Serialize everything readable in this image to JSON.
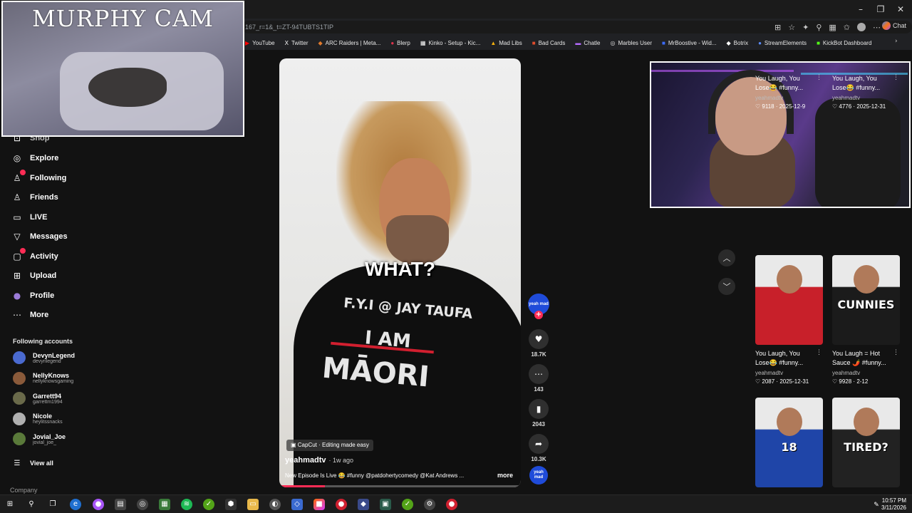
{
  "browser": {
    "address": "167_r=1&_t=ZT-94TUBTS1TIP",
    "chat_label": "Chat",
    "bookmarks": [
      {
        "icon": "youtube-icon",
        "glyph": "▶",
        "label": "YouTube",
        "color": "#ff0000"
      },
      {
        "icon": "x-icon",
        "glyph": "X",
        "label": "Twitter",
        "color": "#ffffff"
      },
      {
        "icon": "arc-icon",
        "glyph": "◆",
        "label": "ARC Raiders | Meta...",
        "color": "#e07a2c"
      },
      {
        "icon": "blerp-icon",
        "glyph": "●",
        "label": "Blerp",
        "color": "#e0334d"
      },
      {
        "icon": "kinko-icon",
        "glyph": "▦",
        "label": "Kinko - Setup - Kic...",
        "color": "#ffffff"
      },
      {
        "icon": "madlibs-icon",
        "glyph": "▲",
        "label": "Mad Libs",
        "color": "#f6b10c"
      },
      {
        "icon": "badcards-icon",
        "glyph": "■",
        "label": "Bad Cards",
        "color": "#e04c2c"
      },
      {
        "icon": "chatle-icon",
        "glyph": "▬",
        "label": "Chatle",
        "color": "#b66cff"
      },
      {
        "icon": "globe-icon",
        "glyph": "◎",
        "label": "Marbles User",
        "color": "#dddddd"
      },
      {
        "icon": "mrboost-icon",
        "glyph": "■",
        "label": "MrBoostive - Wid...",
        "color": "#3b6cff"
      },
      {
        "icon": "botrix-icon",
        "glyph": "◆",
        "label": "Botrix",
        "color": "#ffffff"
      },
      {
        "icon": "streamelements-icon",
        "glyph": "●",
        "label": "StreamElements",
        "color": "#5a8cff"
      },
      {
        "icon": "kickbot-icon",
        "glyph": "■",
        "label": "KickBot Dashboard",
        "color": "#53fc18"
      }
    ]
  },
  "cam1": {
    "title": "MURPHY CAM"
  },
  "sidebar": {
    "partial_label": "Shop",
    "items": [
      {
        "name": "explore",
        "icon": "compass-icon",
        "glyph": "◎",
        "label": "Explore"
      },
      {
        "name": "following",
        "icon": "following-icon",
        "glyph": "♙",
        "label": "Following"
      },
      {
        "name": "friends",
        "icon": "friends-icon",
        "glyph": "♙",
        "label": "Friends"
      },
      {
        "name": "live",
        "icon": "live-icon",
        "glyph": "▭",
        "label": "LIVE"
      },
      {
        "name": "messages",
        "icon": "messages-icon",
        "glyph": "▽",
        "label": "Messages"
      },
      {
        "name": "activity",
        "icon": "activity-icon",
        "glyph": "▢",
        "label": "Activity"
      },
      {
        "name": "upload",
        "icon": "upload-icon",
        "glyph": "⊞",
        "label": "Upload"
      },
      {
        "name": "profile",
        "icon": "profile-icon",
        "glyph": "●",
        "label": "Profile"
      },
      {
        "name": "more",
        "icon": "more-icon",
        "glyph": "⋯",
        "label": "More"
      }
    ],
    "following_title": "Following accounts",
    "accounts": [
      {
        "name": "DevynLegend",
        "handle": "devynlegend",
        "color": "#4a6ad0"
      },
      {
        "name": "NellyKnows",
        "handle": "nellyknowsgaming",
        "color": "#8a5a3a"
      },
      {
        "name": "Garrett94",
        "handle": "garrettm1994",
        "color": "#6a6a4a"
      },
      {
        "name": "Nicole",
        "handle": "heylitssnacks",
        "color": "#b0b0b0"
      },
      {
        "name": "Jovial_Joe",
        "handle": "jovial_joe_",
        "color": "#5a7a3a"
      }
    ],
    "view_all": "View all",
    "company": "Company"
  },
  "video": {
    "caption": "WHAT?",
    "shirt_line1": "F.Y.I @ JAY TAUFA",
    "shirt_line2": "I AM",
    "shirt_line3": "MĀORI",
    "capcut": "CapCut · Editing made easy",
    "username": "yeahmadtv",
    "time": "· 1w ago",
    "description": "New Episode Is Live 😂 #funny @patdohertycomedy @Kat Andrews ...",
    "more": "more",
    "progress": 0.19
  },
  "actions": {
    "avatar_text": "yeah mad",
    "likes": "18.7K",
    "comments": "143",
    "saves": "2043",
    "shares": "10.3K"
  },
  "grid": [
    {
      "title": "You Laugh, You Lose😂 #funny...",
      "user": "yeahmadtv",
      "likes": "9118",
      "date": "2025-12-9",
      "thumb": "none"
    },
    {
      "title": "You Laugh, You Lose😂 #funny...",
      "user": "yeahmadtv",
      "likes": "4776",
      "date": "2025-12-31",
      "thumb": "none"
    },
    {
      "title": "You Laugh, You Lose😂 #funny...",
      "user": "yeahmadtv",
      "likes": "2087",
      "date": "2025-12-31",
      "thumb": "#c8202a",
      "overlay": ""
    },
    {
      "title": "You Laugh = Hot Sauce 🌶️ #funny...",
      "user": "yeahmadtv",
      "likes": "9928",
      "date": "2-12",
      "thumb": "#1b1b1b",
      "overlay": "CUNNIES"
    },
    {
      "title": "",
      "user": "",
      "likes": "",
      "date": "",
      "thumb": "#1f45a8",
      "overlay": "18"
    },
    {
      "title": "",
      "user": "",
      "likes": "",
      "date": "",
      "thumb": "#222222",
      "overlay": "TIRED?"
    }
  ],
  "taskbar": {
    "time": "10:57 PM",
    "date": "3/11/2026"
  }
}
